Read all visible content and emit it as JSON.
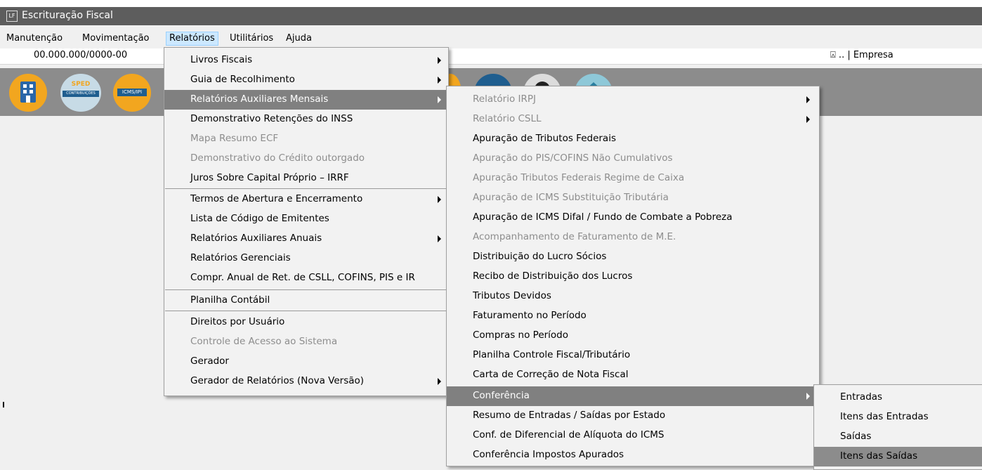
{
  "window": {
    "app_icon": "LF",
    "title": "Escrituração Fiscal"
  },
  "menubar": [
    "Manutenção",
    "Movimentação",
    "Relatórios",
    "Utilitários",
    "Ajuda"
  ],
  "infobar": {
    "cnpj": "00.000.000/0000-00",
    "empresa": "⍓ .. | Empresa"
  },
  "toolbar": {
    "icons": [
      "building-icon",
      "sped-contribuicoes-icon",
      "icms-ipi-icon",
      "app-icon",
      "app-icon",
      "user-avatar-icon",
      "app-icon"
    ],
    "sped_text": "SPED",
    "sped_sub": "CONTRIBUIÇÕES",
    "icms_text": "ICMS/IPI"
  },
  "menu1": {
    "items": [
      {
        "label": "Livros Fiscais",
        "submenu": true
      },
      {
        "label": "Guia de Recolhimento",
        "submenu": true
      },
      {
        "label": "Relatórios Auxiliares Mensais",
        "submenu": true,
        "highlight": true
      },
      {
        "label": "Demonstrativo Retenções do INSS"
      },
      {
        "label": "Mapa Resumo ECF",
        "disabled": true
      },
      {
        "label": "Demonstrativo do Crédito outorgado",
        "disabled": true
      },
      {
        "label": "Juros Sobre Capital Próprio – IRRF"
      },
      {
        "label": "Termos de Abertura e Encerramento",
        "submenu": true
      },
      {
        "label": "Lista de Código de Emitentes"
      },
      {
        "label": "Relatórios Auxiliares Anuais",
        "submenu": true
      },
      {
        "label": "Relatórios Gerenciais"
      },
      {
        "label": "Compr. Anual de Ret. de CSLL, COFINS,  PIS e IR"
      },
      {
        "label": "Planilha Contábil"
      },
      {
        "label": "Direitos por Usuário"
      },
      {
        "label": "Controle de Acesso ao Sistema",
        "disabled": true
      },
      {
        "label": "Gerador"
      },
      {
        "label": "Gerador de Relatórios (Nova Versão)",
        "submenu": true
      }
    ]
  },
  "menu2": {
    "items": [
      {
        "label": "Relatório IRPJ",
        "disabled": true,
        "submenu": true
      },
      {
        "label": "Relatório CSLL",
        "disabled": true,
        "submenu": true
      },
      {
        "label": "Apuração de Tributos Federais"
      },
      {
        "label": "Apuração do PIS/COFINS Não Cumulativos",
        "disabled": true
      },
      {
        "label": "Apuração Tributos Federais Regime de Caixa",
        "disabled": true
      },
      {
        "label": "Apuração de ICMS Substituição Tributária",
        "disabled": true
      },
      {
        "label": "Apuração de ICMS Difal / Fundo de Combate a Pobreza"
      },
      {
        "label": "Acompanhamento de Faturamento de M.E.",
        "disabled": true
      },
      {
        "label": "Distribuição do Lucro Sócios"
      },
      {
        "label": "Recibo de Distribuição dos Lucros"
      },
      {
        "label": "Tributos Devidos"
      },
      {
        "label": "Faturamento no Período"
      },
      {
        "label": "Compras no Período"
      },
      {
        "label": "Planilha Controle Fiscal/Tributário"
      },
      {
        "label": "Carta de Correção de Nota Fiscal"
      },
      {
        "label": "Conferência",
        "submenu": true,
        "highlight": true
      },
      {
        "label": "Resumo de Entradas / Saídas por Estado"
      },
      {
        "label": "Conf. de Diferencial de Alíquota do ICMS"
      },
      {
        "label": "Conferência Impostos Apurados"
      }
    ]
  },
  "menu3": {
    "items": [
      {
        "label": "Entradas"
      },
      {
        "label": "Itens das Entradas"
      },
      {
        "label": "Saídas"
      },
      {
        "label": "Itens das Saídas",
        "highlight": true
      }
    ]
  }
}
